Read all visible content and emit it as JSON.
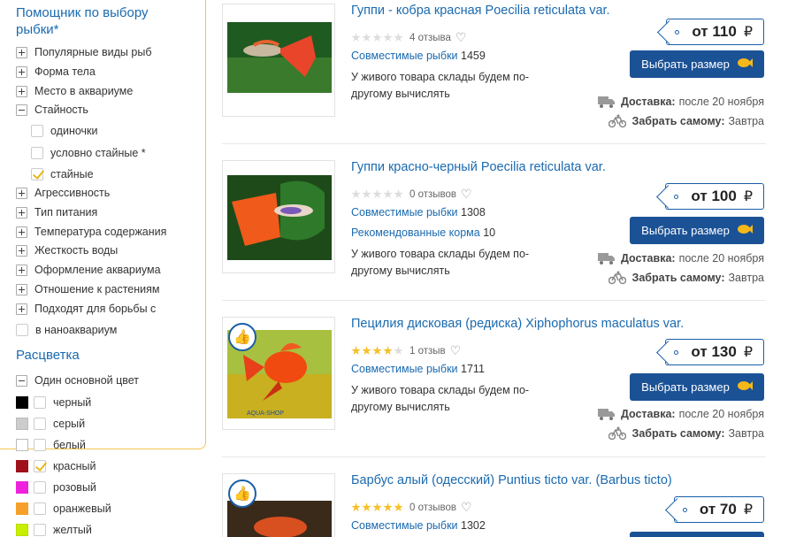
{
  "sidebar": {
    "title": "Помощник по выбору рыбки*",
    "filters": [
      {
        "label": "Популярные виды рыб",
        "state": "plus"
      },
      {
        "label": "Форма тела",
        "state": "plus"
      },
      {
        "label": "Место в аквариуме",
        "state": "plus"
      },
      {
        "label": "Стайность",
        "state": "minus"
      }
    ],
    "stayность_options": [
      {
        "label": "одиночки",
        "checked": false
      },
      {
        "label": "условно стайные *",
        "checked": false
      },
      {
        "label": "стайные",
        "checked": true
      }
    ],
    "more_filters": [
      {
        "label": "Агрессивность"
      },
      {
        "label": "Тип питания"
      },
      {
        "label": "Температура содержания"
      },
      {
        "label": "Жесткость воды"
      },
      {
        "label": "Оформление аквариума"
      },
      {
        "label": "Отношение к растениям"
      },
      {
        "label": "Подходят для борьбы с"
      }
    ],
    "nano_label": "в наноаквариум",
    "color_section": "Расцветка",
    "color_group": "Один основной цвет",
    "colors": [
      {
        "label": "черный",
        "swatch": "#000000",
        "checked": false
      },
      {
        "label": "серый",
        "swatch": "#cccccc",
        "checked": false
      },
      {
        "label": "белый",
        "swatch": "#ffffff",
        "checked": false
      },
      {
        "label": "красный",
        "swatch": "#a0101a",
        "checked": true
      },
      {
        "label": "розовый",
        "swatch": "#ee22dd",
        "checked": false
      },
      {
        "label": "оранжевый",
        "swatch": "#f5a02a",
        "checked": false
      },
      {
        "label": "желтый",
        "swatch": "#c8ee00",
        "checked": false
      }
    ]
  },
  "products": [
    {
      "title": "Гуппи - кобра красная Poecilia reticulata var.",
      "stars": 0,
      "reviews": "4 отзыва",
      "compat_label": "Совместимые рыбки",
      "compat_count": "1459",
      "feed_label": "",
      "feed_count": "",
      "note": "У живого товара склады будем по-другому вычислять",
      "price_prefix": "от",
      "price": "110",
      "currency": "₽",
      "button": "Выбрать размер",
      "delivery_label": "Доставка:",
      "delivery_value": "после 20 ноября",
      "pickup_label": "Забрать самому:",
      "pickup_value": "Завтра",
      "liked": false
    },
    {
      "title": "Гуппи красно-черный Poecilia reticulata var.",
      "stars": 0,
      "reviews": "0 отзывов",
      "compat_label": "Совместимые рыбки",
      "compat_count": "1308",
      "feed_label": "Рекомендованные корма",
      "feed_count": "10",
      "note": "У живого товара склады будем по-другому вычислять",
      "price_prefix": "от",
      "price": "100",
      "currency": "₽",
      "button": "Выбрать размер",
      "delivery_label": "Доставка:",
      "delivery_value": "после 20 ноября",
      "pickup_label": "Забрать самому:",
      "pickup_value": "Завтра",
      "liked": false
    },
    {
      "title": "Пецилия дисковая (редиска) Xiphophorus maculatus var.",
      "stars": 4,
      "reviews": "1 отзыв",
      "compat_label": "Совместимые рыбки",
      "compat_count": "1711",
      "feed_label": "",
      "feed_count": "",
      "note": "У живого товара склады будем по-другому вычислять",
      "price_prefix": "от",
      "price": "130",
      "currency": "₽",
      "button": "Выбрать размер",
      "delivery_label": "Доставка:",
      "delivery_value": "после 20 ноября",
      "pickup_label": "Забрать самому:",
      "pickup_value": "Завтра",
      "liked": true,
      "watermark": "AQUA-SHOP"
    },
    {
      "title": "Барбус алый (одесский) Puntius ticto var. (Barbus ticto)",
      "stars": 5,
      "reviews": "0 отзывов",
      "compat_label": "Совместимые рыбки",
      "compat_count": "1302",
      "price_prefix": "от",
      "price": "70",
      "currency": "₽",
      "liked": true
    }
  ],
  "colors": {
    "link": "#1a6ab0",
    "button": "#1b5296",
    "accent": "#f0c650",
    "star": "#f6c02a"
  }
}
